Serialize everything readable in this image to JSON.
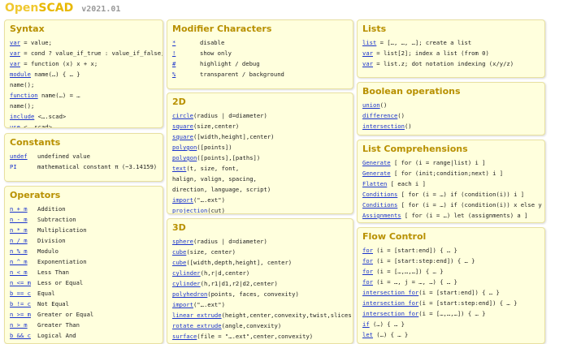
{
  "header": {
    "logo_open": "Open",
    "logo_scad": "SCAD",
    "version": "v2021.01"
  },
  "syntax": {
    "title": "Syntax",
    "lines": [
      "var = value;",
      "var = cond ? value_if_true : value_if_false;",
      "var = function (x) x + x;",
      "module name(…) { … }",
      "name();",
      "function name(…) = …",
      "name();",
      "include <….scad>",
      "use <….scad>"
    ]
  },
  "constants": {
    "title": "Constants",
    "items": [
      {
        "key": "undef",
        "desc": "undefined value"
      },
      {
        "key": "PI",
        "desc": "mathematical constant π (~3.14159)"
      }
    ]
  },
  "operators": {
    "title": "Operators",
    "items": [
      {
        "key": "n + m",
        "desc": "Addition"
      },
      {
        "key": "n - m",
        "desc": "Subtraction"
      },
      {
        "key": "n * m",
        "desc": "Multiplication"
      },
      {
        "key": "n / m",
        "desc": "Division"
      },
      {
        "key": "n % m",
        "desc": "Modulo"
      },
      {
        "key": "n ^ m",
        "desc": "Exponentiation"
      },
      {
        "key": "n < m",
        "desc": "Less Than"
      },
      {
        "key": "n <= m",
        "desc": "Less or Equal"
      },
      {
        "key": "b == c",
        "desc": "Equal"
      },
      {
        "key": "b != c",
        "desc": "Not Equal"
      },
      {
        "key": "n >= m",
        "desc": "Greater or Equal"
      },
      {
        "key": "n > m",
        "desc": "Greater Than"
      },
      {
        "key": "b && c",
        "desc": "Logical And"
      }
    ]
  },
  "modifiers": {
    "title": "Modifier Characters",
    "items": [
      {
        "key": "*",
        "desc": "disable"
      },
      {
        "key": "!",
        "desc": "show only"
      },
      {
        "key": "#",
        "desc": "highlight / debug"
      },
      {
        "key": "%",
        "desc": "transparent / background"
      }
    ]
  },
  "twod": {
    "title": "2D",
    "lines": [
      "circle(radius | d=diameter)",
      "square(size,center)",
      "square([width,height],center)",
      "polygon([points])",
      "polygon([points],[paths])",
      "text(t, size, font,",
      "     halign, valign, spacing,",
      "     direction, language, script)",
      "import(\"….ext\")",
      "projection(cut)"
    ]
  },
  "threed": {
    "title": "3D",
    "lines": [
      "sphere(radius | d=diameter)",
      "cube(size, center)",
      "cube([width,depth,height], center)",
      "cylinder(h,r|d,center)",
      "cylinder(h,r1|d1,r2|d2,center)",
      "polyhedron(points, faces, convexity)",
      "import(\"….ext\")",
      "linear_extrude(height,center,convexity,twist,slices)",
      "rotate_extrude(angle,convexity)",
      "surface(file = \"….ext\",center,convexity)"
    ]
  },
  "lists": {
    "title": "Lists",
    "lines": [
      "list = […, …, …];  create a list",
      "var = list[2];  index a list (from 0)",
      "var = list.z;  dot notation indexing (x/y/z)"
    ]
  },
  "boolean": {
    "title": "Boolean operations",
    "lines": [
      "union()",
      "difference()",
      "intersection()"
    ]
  },
  "comprehensions": {
    "title": "List Comprehensions",
    "lines": [
      "Generate [ for (i = range|list) i ]",
      "Generate [ for (init;condition;next) i ]",
      "Flatten [ each i ]",
      "Conditions [ for (i = …) if (condition(i)) i ]",
      "Conditions [ for (i = …) if (condition(i)) x else y ]",
      "Assignments [ for (i = …) let (assignments) a ]"
    ]
  },
  "flow": {
    "title": "Flow Control",
    "lines": [
      "for (i = [start:end]) { … }",
      "for (i = [start:step:end]) { … }",
      "for (i = […,…,…]) { … }",
      "for (i = …, j = …, …) { … }",
      "intersection_for(i = [start:end]) { … }",
      "intersection_for(i = [start:step:end]) { … }",
      "intersection_for(i = […,…,…]) { … }",
      "if (…) { … }",
      "let (…) { … }"
    ]
  }
}
